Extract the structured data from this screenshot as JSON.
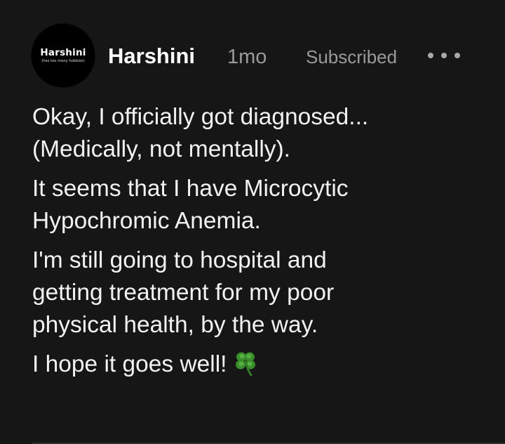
{
  "post": {
    "avatar": {
      "name": "Harshini",
      "tagline": "(has too many hobbies)"
    },
    "author": "Harshini",
    "time": "1mo",
    "subscription_status": "Subscribed",
    "more_icon": "more-horizontal-icon",
    "paragraphs": [
      [
        "Okay, I officially got diagnosed...",
        "(Medically, not mentally)."
      ],
      [
        "It seems that I have Microcytic",
        "Hypochromic Anemia."
      ],
      [
        "I'm still going to hospital and",
        "getting treatment for my poor",
        "physical health, by the way."
      ],
      [
        "I hope it goes well!"
      ]
    ],
    "emoji": "four-leaf-clover-icon"
  },
  "colors": {
    "background": "#161616",
    "text": "#f2f2f2",
    "muted": "#9a9a9a",
    "clover": "#3a8f2c"
  }
}
